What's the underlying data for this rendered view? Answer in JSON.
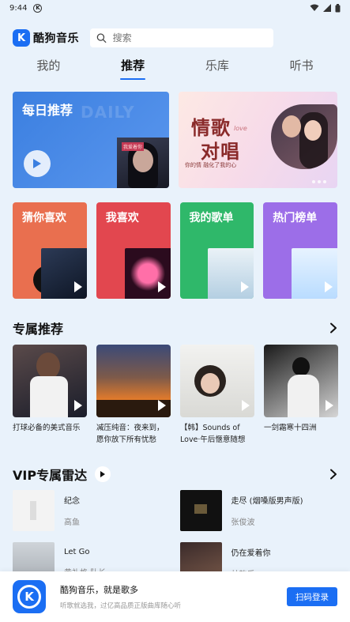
{
  "status_bar": {
    "time": "9:44",
    "app_icon_letter": "K"
  },
  "header": {
    "logo_mark": "K",
    "logo_text": "酷狗音乐",
    "search_placeholder": "搜索"
  },
  "tabs": [
    {
      "label": "我的",
      "active": false
    },
    {
      "label": "推荐",
      "active": true
    },
    {
      "label": "乐库",
      "active": false
    },
    {
      "label": "听书",
      "active": false
    }
  ],
  "banners": {
    "daily": {
      "title": "每日推荐",
      "watermark": "DAILY",
      "cover_tag": "我爱着你"
    },
    "duet": {
      "line1": "情歌",
      "line2": "对唱",
      "love": "love",
      "subtitle": "你的情 融化了我的心"
    }
  },
  "quick_entries": [
    {
      "label": "猜你喜欢"
    },
    {
      "label": "我喜欢"
    },
    {
      "label": "我的歌单"
    },
    {
      "label": "热门榜单"
    }
  ],
  "exclusive": {
    "title": "专属推荐",
    "playlists": [
      {
        "caption": "打球必备的美式音乐"
      },
      {
        "caption": "减压纯音：夜来到，愿你放下所有忧愁"
      },
      {
        "caption": "【韩】Sounds of Love·午后惬意随想"
      },
      {
        "caption": "一剑霜寒十四洲"
      }
    ]
  },
  "vip": {
    "title": "VIP专属雷达",
    "songs": [
      {
        "name": "纪念",
        "artist": "高鱼"
      },
      {
        "name": "走尽 (烟嗓版男声版)",
        "artist": "张俊波"
      },
      {
        "name": "Let Go",
        "artist": "黄礼格 队长"
      },
      {
        "name": "仍在爱着你",
        "artist": "林韵乐"
      }
    ]
  },
  "bottom_bar": {
    "logo_letter": "K",
    "title": "酷狗音乐，就是歌多",
    "subtitle": "听歌就选我，过亿高品质正版曲库随心听",
    "button": "扫码登录"
  },
  "colors": {
    "brand_blue": "#1b6ef3",
    "background": "#e9f2fb",
    "card_orange": "#e96f4f",
    "card_red": "#e2474f",
    "card_green": "#2fb86a",
    "card_purple": "#9c6ee8"
  }
}
